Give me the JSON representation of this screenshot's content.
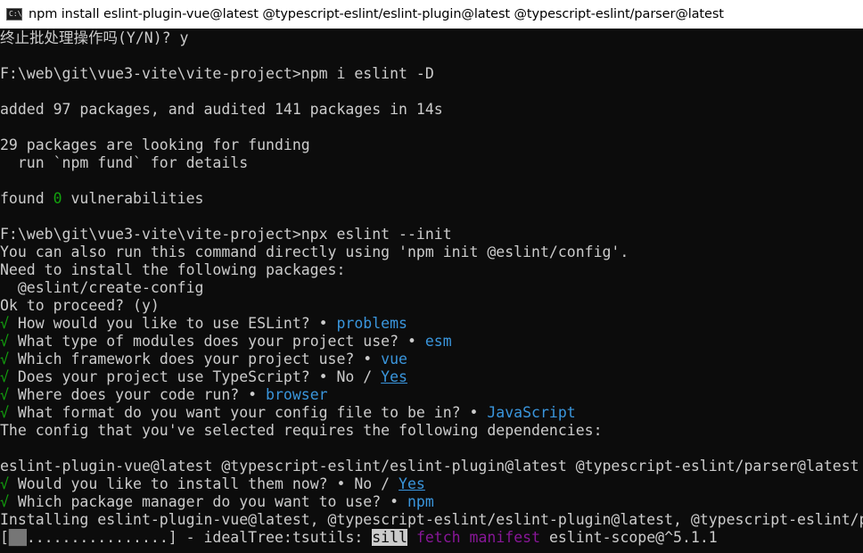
{
  "window": {
    "title": "npm install eslint-plugin-vue@latest @typescript-eslint/eslint-plugin@latest @typescript-eslint/parser@latest",
    "icon": "cmd-icon",
    "icon_text": "C:\\"
  },
  "console": {
    "l1": "终止批处理操作吗(Y/N)? y",
    "l3": "F:\\web\\git\\vue3-vite\\vite-project>npm i eslint -D",
    "l5": "added 97 packages, and audited 141 packages in 14s",
    "l7": "29 packages are looking for funding",
    "l8": "  run `npm fund` for details",
    "l10_a": "found ",
    "l10_b": "0",
    "l10_c": " vulnerabilities",
    "l12": "F:\\web\\git\\vue3-vite\\vite-project>npx eslint --init",
    "l13": "You can also run this command directly using 'npm init @eslint/config'.",
    "l14": "Need to install the following packages:",
    "l15": "  @eslint/create-config",
    "l16": "Ok to proceed? (y)",
    "check": "√",
    "dot": "•",
    "q1": " How would you like to use ESLint? ",
    "a1": "problems",
    "q2": " What type of modules does your project use? ",
    "a2": "esm",
    "q3": " Which framework does your project use? ",
    "a3": "vue",
    "q4": " Does your project use TypeScript? ",
    "a4_no": " No / ",
    "a4_yes": "Yes",
    "q5": " Where does your code run? ",
    "a5": "browser",
    "q6": " What format do you want your config file to be in? ",
    "a6": "JavaScript",
    "l23": "The config that you've selected requires the following dependencies:",
    "l25": "eslint-plugin-vue@latest @typescript-eslint/eslint-plugin@latest @typescript-eslint/parser@latest",
    "q7": " Would you like to install them now? ",
    "a7_no": " No / ",
    "a7_yes": "Yes",
    "q8": " Which package manager do you want to use? ",
    "a8": "npm",
    "l28": "Installing eslint-plugin-vue@latest, @typescript-eslint/eslint-plugin@latest, @typescript-eslint/parser@latest",
    "p_open": "[",
    "p_block": "██",
    "p_dots": "................",
    "p_close": "] - idealTree:tsutils: ",
    "p_sill": "sill",
    "p_fetch": "fetch",
    "p_manifest": "manifest",
    "p_pkg": "eslint-scope@^5.1.1"
  }
}
